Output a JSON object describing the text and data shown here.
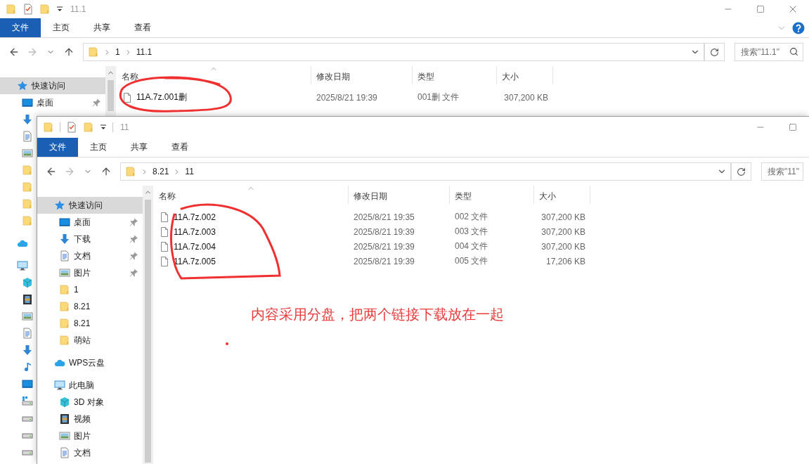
{
  "back_window": {
    "title": "11.1",
    "controls": [
      {
        "kind": "minimize"
      },
      {
        "kind": "maximize"
      },
      {
        "kind": "close"
      }
    ],
    "ribbon_tabs": [
      {
        "label": "文件",
        "kind": "menu"
      },
      {
        "label": "主页",
        "kind": "tab"
      },
      {
        "label": "共享",
        "kind": "tab"
      },
      {
        "label": "查看",
        "kind": "tab"
      }
    ],
    "help_button": true,
    "address": [
      "1",
      "11.1"
    ],
    "search": {
      "placeholder": "搜索\"11.1\"",
      "icon": true
    },
    "columns": [
      "名称",
      "修改日期",
      "类型",
      "大小"
    ],
    "rows": [
      {
        "name": "11A.7z.001删",
        "date": "2025/8/21 19:39",
        "type": "001删 文件",
        "size": "307,200 KB"
      }
    ],
    "nav": [
      {
        "kind": "quick",
        "label": "快速访问",
        "selected": true,
        "pinned": false
      },
      {
        "kind": "desktop",
        "label": "桌面",
        "selected": false,
        "pinned": true
      },
      {
        "kind": "download"
      },
      {
        "kind": "doc"
      },
      {
        "kind": "picture"
      },
      {
        "kind": "folder"
      },
      {
        "kind": "folder"
      },
      {
        "kind": "folder"
      },
      {
        "kind": "folder"
      },
      {
        "kind": "cloud"
      },
      {
        "kind": "pc"
      },
      {
        "kind": "cube"
      },
      {
        "kind": "video"
      },
      {
        "kind": "picture"
      },
      {
        "kind": "doc"
      },
      {
        "kind": "download"
      },
      {
        "kind": "music"
      },
      {
        "kind": "desktop"
      },
      {
        "kind": "windrive"
      },
      {
        "kind": "drive"
      },
      {
        "kind": "drive"
      },
      {
        "kind": "drive"
      }
    ]
  },
  "front_window": {
    "title": "11",
    "controls": [
      {
        "kind": "minimize"
      },
      {
        "kind": "maximize"
      }
    ],
    "ribbon_tabs": [
      {
        "label": "文件",
        "kind": "menu"
      },
      {
        "label": "主页",
        "kind": "tab"
      },
      {
        "label": "共享",
        "kind": "tab"
      },
      {
        "label": "查看",
        "kind": "tab"
      }
    ],
    "address": [
      "8.21",
      "11"
    ],
    "search": {
      "placeholder": "搜索\"11\""
    },
    "columns": [
      "名称",
      "修改日期",
      "类型",
      "大小"
    ],
    "rows": [
      {
        "name": "11A.7z.002",
        "date": "2025/8/21 19:35",
        "type": "002 文件",
        "size": "307,200 KB"
      },
      {
        "name": "11A.7z.003",
        "date": "2025/8/21 19:39",
        "type": "003 文件",
        "size": "307,200 KB"
      },
      {
        "name": "11A.7z.004",
        "date": "2025/8/21 19:39",
        "type": "004 文件",
        "size": "307,200 KB"
      },
      {
        "name": "11A.7z.005",
        "date": "2025/8/21 19:39",
        "type": "005 文件",
        "size": "17,206 KB"
      }
    ],
    "nav": [
      {
        "kind": "quick",
        "label": "快速访问",
        "selected": true,
        "pinned": false
      },
      {
        "kind": "desktop",
        "label": "桌面",
        "selected": false,
        "pinned": true
      },
      {
        "kind": "download",
        "label": "下载",
        "selected": false,
        "pinned": true
      },
      {
        "kind": "doc",
        "label": "文档",
        "selected": false,
        "pinned": true
      },
      {
        "kind": "picture",
        "label": "图片",
        "selected": false,
        "pinned": true
      },
      {
        "kind": "folder",
        "label": "1",
        "selected": false,
        "pinned": false
      },
      {
        "kind": "folder",
        "label": "8.21",
        "selected": false,
        "pinned": false
      },
      {
        "kind": "folder",
        "label": "8.21",
        "selected": false,
        "pinned": false
      },
      {
        "kind": "folder",
        "label": "萌站",
        "selected": false,
        "pinned": false
      },
      {
        "kind": "cloud",
        "label": "WPS云盘",
        "selected": false,
        "pinned": false
      },
      {
        "kind": "pc",
        "label": "此电脑",
        "selected": false,
        "pinned": false
      },
      {
        "kind": "cube",
        "label": "3D 对象",
        "selected": false,
        "pinned": false
      },
      {
        "kind": "video",
        "label": "视频",
        "selected": false,
        "pinned": false
      },
      {
        "kind": "picture",
        "label": "图片",
        "selected": false,
        "pinned": false
      },
      {
        "kind": "doc",
        "label": "文档",
        "selected": false,
        "pinned": false
      }
    ]
  },
  "annotation": {
    "note": "内容采用分盘，把两个链接下载放在一起"
  }
}
